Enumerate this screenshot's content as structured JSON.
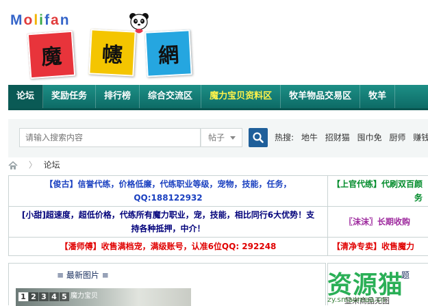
{
  "logo": {
    "word": [
      "M",
      "o",
      "l",
      "i",
      "f",
      "a",
      "n"
    ],
    "word_colors": [
      "#3565c9",
      "#e13b3b",
      "#f2b400",
      "#39a845",
      "#3565c9",
      "#e13b3b",
      "#3565c9"
    ],
    "tiles": [
      "魔",
      "幰",
      "網"
    ]
  },
  "nav": {
    "items": [
      "论坛",
      "奖励任务",
      "排行榜",
      "综合交流区",
      "魔力宝贝资料区",
      "牧羊物品交易区",
      "牧羊"
    ]
  },
  "search": {
    "placeholder": "请输入搜索内容",
    "type": "帖子",
    "hot_label": "热搜:",
    "hot": [
      "地牛",
      "招财猫",
      "囤巾免",
      "厨师",
      "赚钱"
    ]
  },
  "breadcrumb": {
    "current": "论坛"
  },
  "ads": {
    "r1_left_a": "【俊古】信誉代练，价格低廉，代练职业等级，宠物，技能，任务，",
    "r1_left_b": "QQ:188122932",
    "r1_right": "【上官代练】代刷双百颜",
    "r1_right_tail": "务",
    "r2_left_a": "[小甜]超速度，超低价格，代练所有魔力职业，宠，技能，相比同行6大优势！支",
    "r2_left_b": "持各种抵押，中介！",
    "r2_right": "〖沫沫〗长期收购",
    "r3_left": "【潘师傅】收售满档宠，满级账号，认准6位QQ: 292248",
    "r3_right": "【清净专卖】收售魔力"
  },
  "panels": {
    "latest_pics": "≡ 最新图片 ≡",
    "thumb_tabs": [
      "1",
      "2",
      "3",
      "4",
      "5"
    ],
    "thumb_caption": "魔力宝贝",
    "right_title": "题",
    "right_sub": "显米商品无图"
  },
  "watermark": {
    "text": "资源猫",
    "url": "zy.smaomao.cn"
  }
}
